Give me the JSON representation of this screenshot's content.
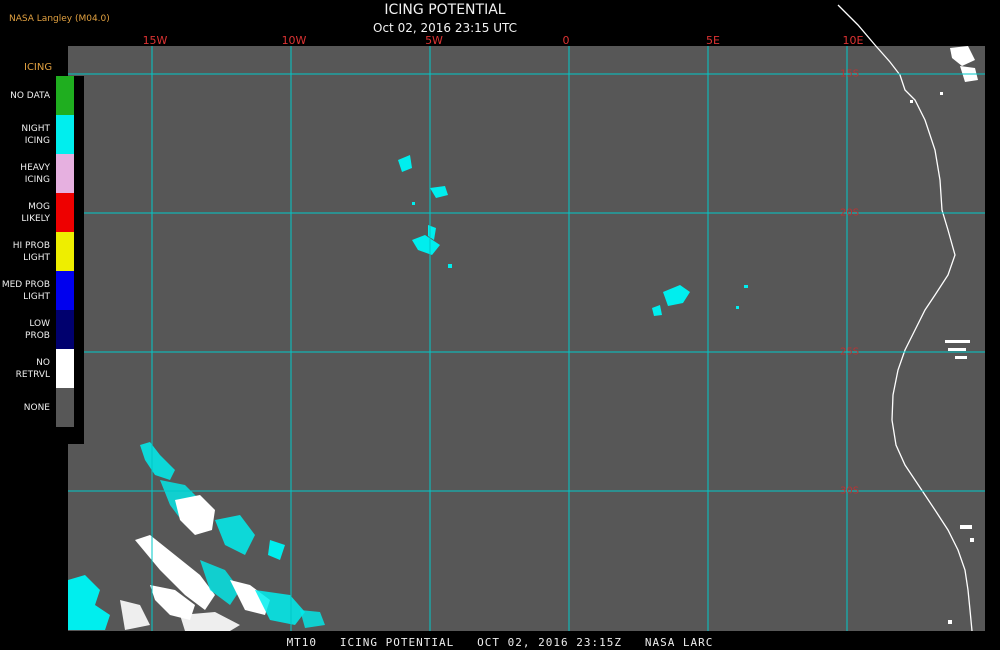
{
  "header": {
    "source": "NASA Langley (M04.0)",
    "title": "ICING POTENTIAL",
    "datetime": "Oct 02, 2016 23:15 UTC"
  },
  "map": {
    "lon_labels": [
      "15W",
      "10W",
      "5W",
      "0",
      "5E",
      "10E"
    ],
    "lat_labels": [
      "15S",
      "20S",
      "25S",
      "30S"
    ]
  },
  "legend": {
    "title": "ICING",
    "items": [
      {
        "label": "NO DATA",
        "color": "#1fae1f"
      },
      {
        "label": "NIGHT\nICING",
        "color": "#00eeee"
      },
      {
        "label": "HEAVY\nICING",
        "color": "#e6b0e0"
      },
      {
        "label": "MOG\nLIKELY",
        "color": "#ee0000"
      },
      {
        "label": "HI PROB\nLIGHT",
        "color": "#eeee00"
      },
      {
        "label": "MED PROB\nLIGHT",
        "color": "#0000ee"
      },
      {
        "label": "LOW\nPROB",
        "color": "#00006e"
      },
      {
        "label": "NO\nRETRVL",
        "color": "#ffffff"
      },
      {
        "label": "NONE",
        "color": "#575757"
      }
    ]
  },
  "footer": "MT10   ICING POTENTIAL   OCT 02, 2016 23:15Z   NASA LARC"
}
